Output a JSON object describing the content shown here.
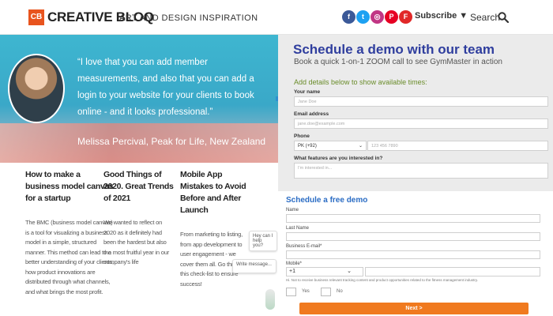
{
  "header": {
    "logo_mark": "CB",
    "logo_text": "CREATIVE BLOQ",
    "tagline": "ART AND DESIGN INSPIRATION",
    "socials": [
      {
        "icon": "facebook-icon",
        "glyph": "f",
        "color": "#3b5998"
      },
      {
        "icon": "twitter-icon",
        "glyph": "t",
        "color": "#1da1f2"
      },
      {
        "icon": "instagram-icon",
        "glyph": "◎",
        "color": "#c13584"
      },
      {
        "icon": "pinterest-icon",
        "glyph": "P",
        "color": "#e60023"
      },
      {
        "icon": "flipboard-icon",
        "glyph": "F",
        "color": "#e12828"
      }
    ],
    "subscribe_label": "Subscribe ▼",
    "search_label": "Search"
  },
  "hero": {
    "quote": "“I love that you can add member measurements, and also that you can add a login to your website for your clients to book online - and it looks professional.”",
    "attribution": "Melissa Percival, Peak for Life, New Zealand"
  },
  "articles": [
    {
      "title": "How to make a business model canvas for a startup",
      "body": "The BMC (business model canvas) is a tool for visualizing a business model in a simple, structured manner. This method can lead to a better understanding of your clients, how product innovations are distributed through what channels, and what brings the most profit."
    },
    {
      "title": "Good Things of 2020. Great Trends of 2021",
      "body": "We wanted to reflect on 2020 as it definitely had been the hardest but also the most fruitful year in our company's life"
    },
    {
      "title": "Mobile App Mistakes to Avoid Before and After Launch",
      "body": "From marketing to listing, from app development to user engagement - we cover them all. Go through this check-list to ensure success!"
    }
  ],
  "chat": {
    "greeting": "Hey can I help you?",
    "input_placeholder": "Write message..."
  },
  "gym_form": {
    "title": "Schedule a demo with our team",
    "subtitle": "Book a quick 1-on-1 ZOOM call to see GymMaster in action",
    "intro": "Add details below to show available times:",
    "name_label": "Your name",
    "name_placeholder": "Jane Doe",
    "email_label": "Email address",
    "email_placeholder": "jane.doe@example.com",
    "phone_label": "Phone",
    "phone_country": "PK (+92)",
    "phone_placeholder": "123 456 7890",
    "features_label": "What features are you interested in?",
    "features_placeholder": "I'm interested in..."
  },
  "free_form": {
    "title": "Schedule a free demo",
    "name_label": "Name",
    "last_name_label": "Last Name",
    "email_label": "Business E-mail*",
    "mobile_label": "Mobile*",
    "mobile_code": "+1",
    "consent_note": "Hi. Not to receive business relevant tracking content and product opportunities related to the fitness management industry.",
    "yes_label": "Yes",
    "no_label": "No",
    "next_label": "Next  >"
  }
}
